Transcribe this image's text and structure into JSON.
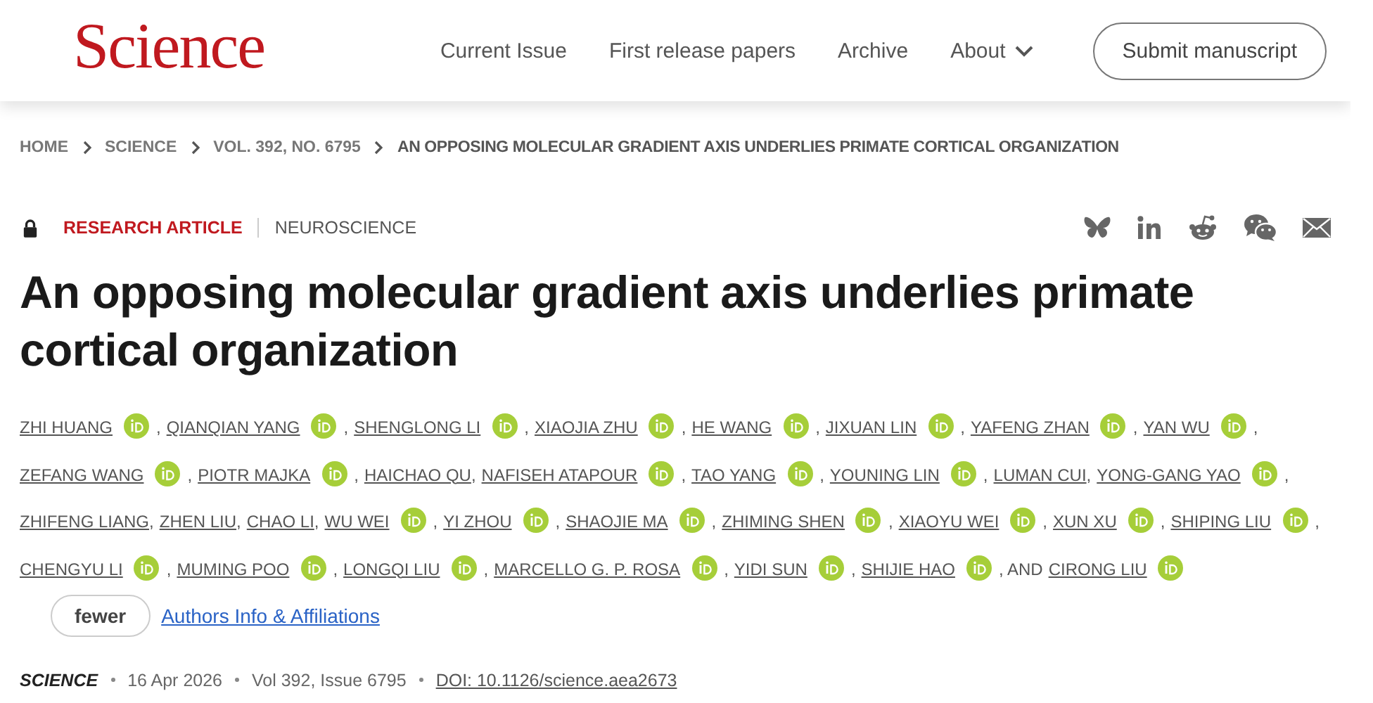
{
  "header": {
    "logo": "Science",
    "nav": [
      {
        "label": "Current Issue",
        "dropdown": false
      },
      {
        "label": "First release papers",
        "dropdown": false
      },
      {
        "label": "Archive",
        "dropdown": false
      },
      {
        "label": "About",
        "dropdown": true
      }
    ],
    "submit_button": "Submit manuscript"
  },
  "breadcrumb": [
    {
      "label": "HOME",
      "current": false
    },
    {
      "label": "SCIENCE",
      "current": false
    },
    {
      "label": "VOL. 392, NO. 6795",
      "current": false
    },
    {
      "label": "AN OPPOSING MOLECULAR GRADIENT AXIS UNDERLIES PRIMATE CORTICAL ORGANIZATION",
      "current": true
    }
  ],
  "article": {
    "article_type": "RESEARCH ARTICLE",
    "subject": "NEUROSCIENCE",
    "share": [
      {
        "kind": "bluesky"
      },
      {
        "kind": "linkedin"
      },
      {
        "kind": "reddit"
      },
      {
        "kind": "wechat"
      },
      {
        "kind": "email"
      }
    ],
    "title": "An opposing molecular gradient axis underlies primate cortical organization",
    "authors": [
      {
        "name": "ZHI HUANG",
        "orcid": true,
        "separator": ","
      },
      {
        "name": "QIANQIAN YANG",
        "orcid": true,
        "separator": ","
      },
      {
        "name": "SHENGLONG LI",
        "orcid": true,
        "separator": ","
      },
      {
        "name": "XIAOJIA ZHU",
        "orcid": true,
        "separator": ","
      },
      {
        "name": "HE WANG",
        "orcid": true,
        "separator": ","
      },
      {
        "name": "JIXUAN LIN",
        "orcid": true,
        "separator": ","
      },
      {
        "name": "YAFENG ZHAN",
        "orcid": true,
        "separator": ","
      },
      {
        "name": "YAN WU",
        "orcid": true,
        "separator": ","
      },
      {
        "name": "ZEFANG WANG",
        "orcid": true,
        "separator": ","
      },
      {
        "name": "PIOTR MAJKA",
        "orcid": true,
        "separator": ","
      },
      {
        "name": "HAICHAO QU",
        "orcid": false,
        "separator": ","
      },
      {
        "name": "NAFISEH ATAPOUR",
        "orcid": true,
        "separator": ","
      },
      {
        "name": "TAO YANG",
        "orcid": true,
        "separator": ","
      },
      {
        "name": "YOUNING LIN",
        "orcid": true,
        "separator": ","
      },
      {
        "name": "LUMAN CUI",
        "orcid": false,
        "separator": ","
      },
      {
        "name": "YONG-GANG YAO",
        "orcid": true,
        "separator": ","
      },
      {
        "name": "ZHIFENG LIANG",
        "orcid": false,
        "separator": ","
      },
      {
        "name": "ZHEN LIU",
        "orcid": false,
        "separator": ","
      },
      {
        "name": "CHAO LI",
        "orcid": false,
        "separator": ","
      },
      {
        "name": "WU WEI",
        "orcid": true,
        "separator": ","
      },
      {
        "name": "YI ZHOU",
        "orcid": true,
        "separator": ","
      },
      {
        "name": "SHAOJIE MA",
        "orcid": true,
        "separator": ","
      },
      {
        "name": "ZHIMING SHEN",
        "orcid": true,
        "separator": ","
      },
      {
        "name": "XIAOYU WEI",
        "orcid": true,
        "separator": ","
      },
      {
        "name": "XUN XU",
        "orcid": true,
        "separator": ","
      },
      {
        "name": "SHIPING LIU",
        "orcid": true,
        "separator": ","
      },
      {
        "name": "CHENGYU LI",
        "orcid": true,
        "separator": ","
      },
      {
        "name": "MUMING POO",
        "orcid": true,
        "separator": ","
      },
      {
        "name": "LONGQI LIU",
        "orcid": true,
        "separator": ","
      },
      {
        "name": "MARCELLO G. P. ROSA",
        "orcid": true,
        "separator": ","
      },
      {
        "name": "YIDI SUN",
        "orcid": true,
        "separator": ","
      },
      {
        "name": "SHIJIE HAO",
        "orcid": true,
        "separator": ", AND"
      },
      {
        "name": "CIRONG LIU",
        "orcid": true
      }
    ],
    "fewer_button": "fewer",
    "affiliations_link": "Authors Info & Affiliations",
    "journal": "SCIENCE",
    "date": "16 Apr 2026",
    "volume": "Vol 392, Issue 6795",
    "doi": "DOI: 10.1126/science.aea2673"
  }
}
